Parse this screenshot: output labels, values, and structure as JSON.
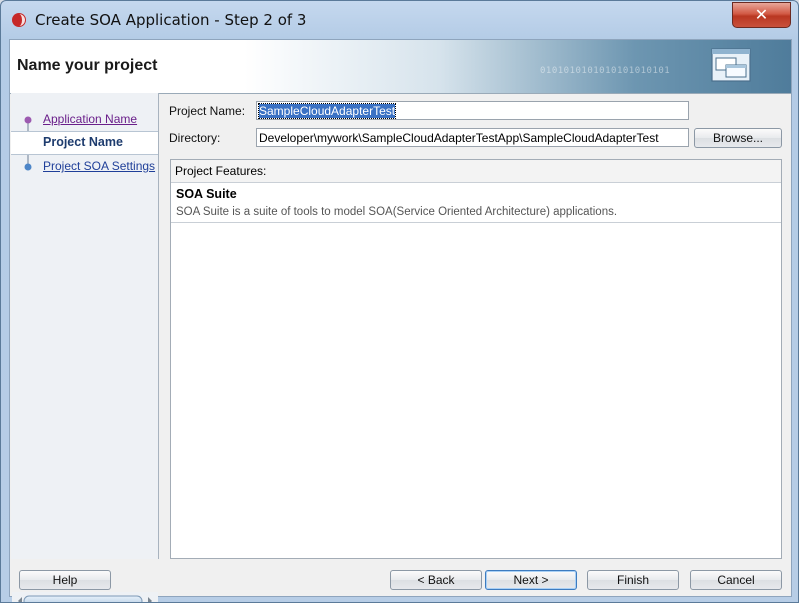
{
  "window": {
    "title": "Create SOA Application - Step 2 of 3",
    "close_label": "✕"
  },
  "header": {
    "title": "Name your project",
    "decor_binary": "0101010101010101010101"
  },
  "steps": [
    {
      "label": "Application Name",
      "state": "visited"
    },
    {
      "label": "Project Name",
      "state": "current"
    },
    {
      "label": "Project SOA Settings",
      "state": "link"
    }
  ],
  "form": {
    "project_name_label": "Project Name:",
    "project_name_value": "SampleCloudAdapterTest",
    "directory_label": "Directory:",
    "directory_value": "Developer\\mywork\\SampleCloudAdapterTestApp\\SampleCloudAdapterTest",
    "browse_label": "Browse..."
  },
  "features": {
    "header": "Project Features:",
    "items": [
      {
        "title": "SOA Suite",
        "description": "SOA Suite is a suite of tools to model SOA(Service Oriented Architecture) applications."
      }
    ]
  },
  "footer": {
    "help": "Help",
    "back": "< Back",
    "next": "Next >",
    "finish": "Finish",
    "cancel": "Cancel"
  },
  "colors": {
    "accent": "#3b72c4",
    "link": "#1f3f99",
    "visited_link": "#6a1f8a",
    "close_red": "#c9513b"
  }
}
